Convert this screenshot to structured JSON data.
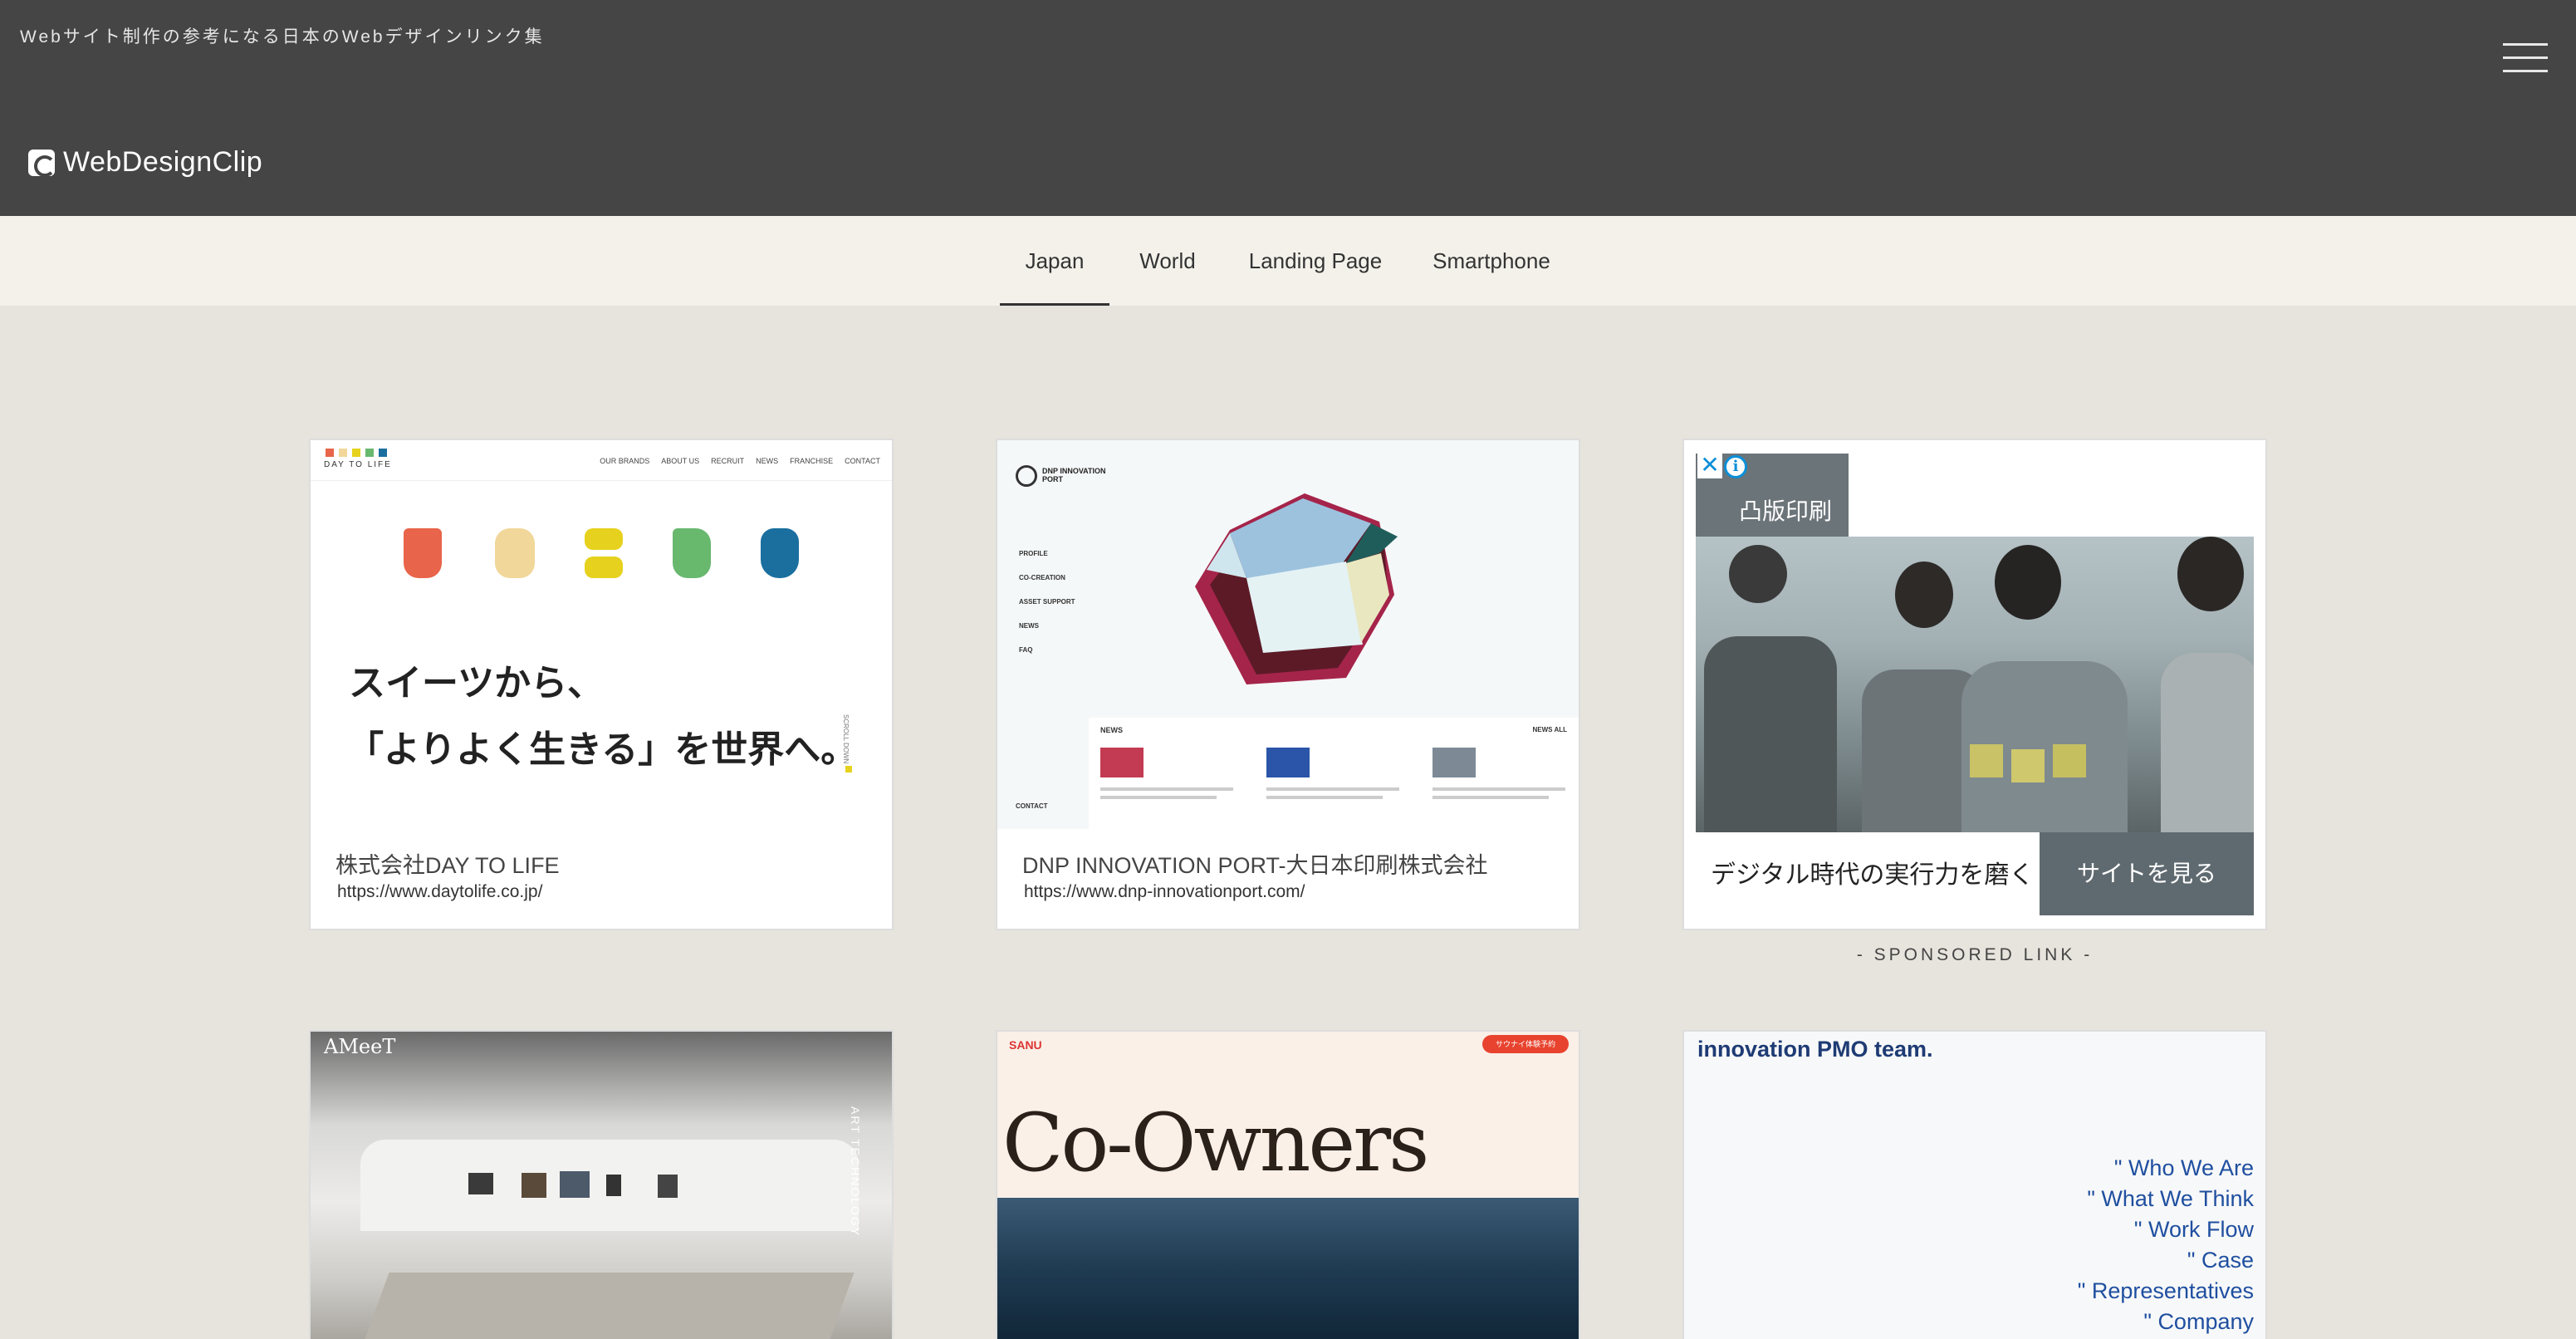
{
  "header": {
    "tagline": "Webサイト制作の参考になる日本のWebデザインリンク集",
    "logo_text": "WebDesignClip"
  },
  "nav": {
    "items": [
      {
        "label": "Japan",
        "active": true
      },
      {
        "label": "World"
      },
      {
        "label": "Landing Page"
      },
      {
        "label": "Smartphone"
      }
    ]
  },
  "cards": [
    {
      "title": "株式会社DAY TO LIFE",
      "url": "https://www.daytolife.co.jp/",
      "preview": {
        "logo": "DAY TO LIFE",
        "nav": [
          "OUR BRANDS",
          "ABOUT US",
          "RECRUIT",
          "NEWS",
          "FRANCHISE",
          "CONTACT"
        ],
        "line1": "スイーツから、",
        "line2": "「よりよく生きる」を世界へ。",
        "side": "SCROLL DOWN"
      }
    },
    {
      "title": "DNP INNOVATION PORT-大日本印刷株式会社",
      "url": "https://www.dnp-innovationport.com/",
      "preview": {
        "logo": "DNP INNOVATION PORT",
        "menu": [
          "PROFILE",
          "CO-CREATION",
          "ASSET SUPPORT",
          "NEWS",
          "FAQ"
        ],
        "news": "NEWS",
        "news_all": "NEWS ALL",
        "contact": "CONTACT"
      }
    },
    {
      "preview": {
        "logo": "AMeeT",
        "side": "ART TECHNOLOGY"
      }
    },
    {
      "preview": {
        "brand": "SANU",
        "headline": "Co-Owners",
        "cta": "サウナイ体験予約"
      }
    },
    {
      "preview": {
        "headline": "innovation PMO team.",
        "links": [
          "Who We Are",
          "What We Think",
          "Work Flow",
          "Case",
          "Representatives",
          "Company"
        ]
      }
    }
  ],
  "ad": {
    "brand": "凸版印刷",
    "close_glyph": "✕",
    "info_glyph": "i",
    "text": "デジタル時代の実行力を磨く",
    "cta": "サイトを見る",
    "sponsored_label": "- SPONSORED LINK -"
  },
  "colors": {
    "header_bg": "#454545",
    "nav_bg": "#f3f1ea",
    "page_bg": "#e7e4dd",
    "ad_cta_bg": "#5f6a70"
  },
  "icons": {
    "menu": "hamburger-icon",
    "logo": "webdesignclip-logo-icon",
    "ad_close": "close-icon",
    "ad_info": "info-icon"
  }
}
